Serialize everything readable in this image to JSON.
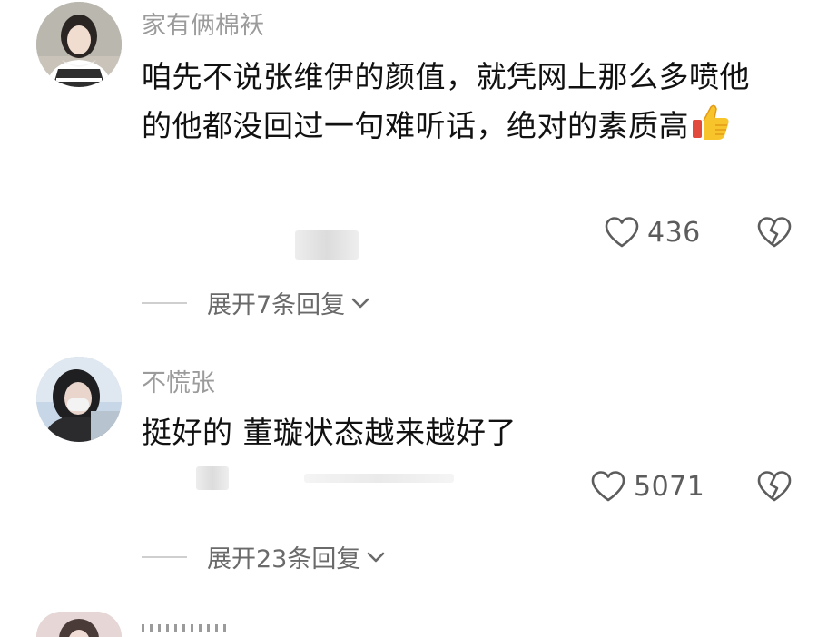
{
  "comments": [
    {
      "username": "家有俩棉袄",
      "text": "咱先不说张维伊的颜值，就凭网上那么多喷他的他都没回过一句难听话，绝对的素质高",
      "emoji": "thumbs-up",
      "likes": "436",
      "expand_label": "展开7条回复"
    },
    {
      "username": "不慌张",
      "text": "挺好的 董璇状态越来越好了",
      "likes": "5071",
      "expand_label": "展开23条回复"
    }
  ],
  "colors": {
    "username": "#9b9b9b",
    "text": "#111111",
    "like_count": "#5c5c5c",
    "expand_label": "#6a6a6a"
  },
  "icons": [
    "heart-icon",
    "broken-heart-icon",
    "chevron-down-icon",
    "thumbs-up-icon"
  ]
}
